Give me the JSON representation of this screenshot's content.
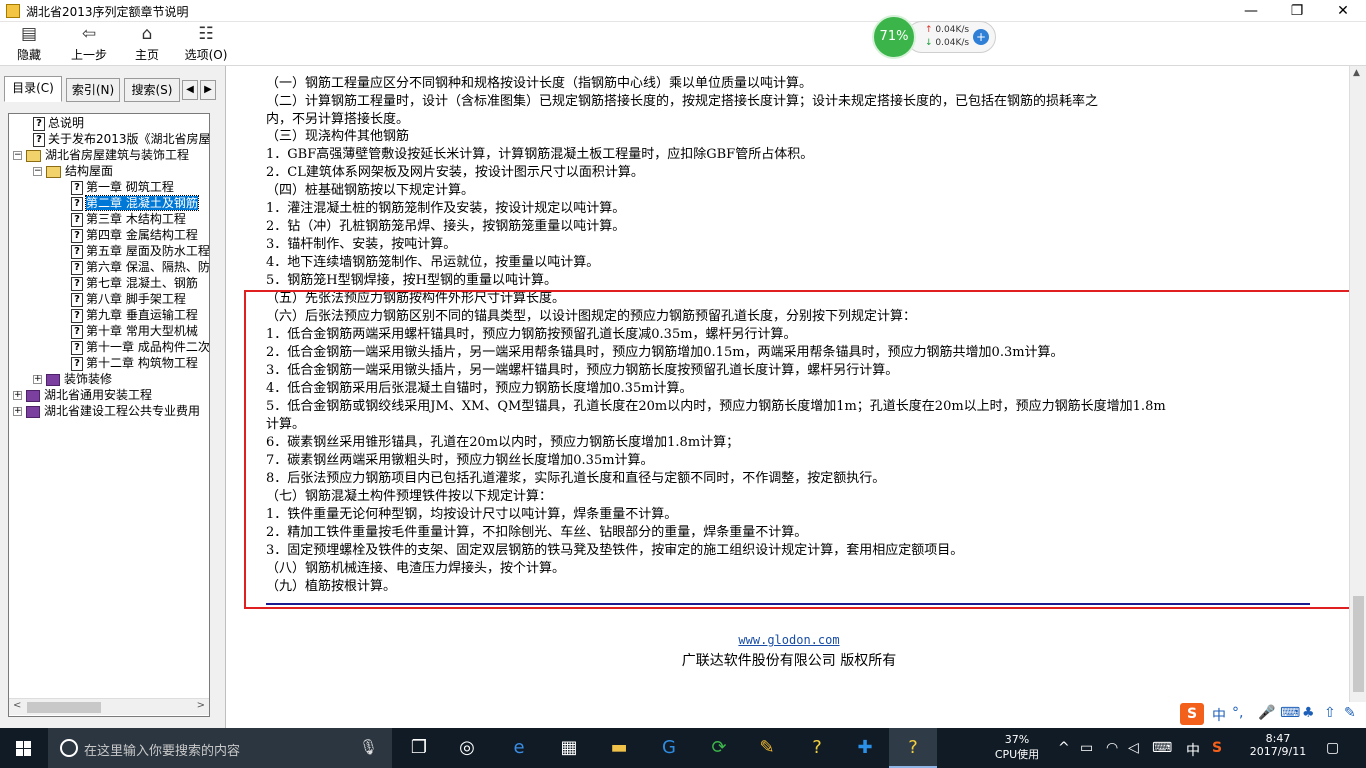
{
  "window": {
    "title": "湖北省2013序列定额章节说明",
    "controls": {
      "minimize": "—",
      "maximize": "❐",
      "close": "✕"
    }
  },
  "toolbar": {
    "hide": "隐藏",
    "back": "上一步",
    "home": "主页",
    "options": "选项(O)"
  },
  "monitor": {
    "percent": "71%",
    "upload": "0.04K/s",
    "download": "0.04K/s"
  },
  "sidebar": {
    "tabs": [
      "目录(C)",
      "索引(N)",
      "搜索(S)"
    ],
    "tree": [
      "总说明",
      "关于发布2013版《湖北省房屋",
      "湖北省房屋建筑与装饰工程",
      "结构屋面",
      "第一章 砌筑工程",
      "第二章 混凝土及钢筋",
      "第三章 木结构工程",
      "第四章 金属结构工程",
      "第五章 屋面及防水工程",
      "第六章 保温、隔热、防",
      "第七章 混凝土、钢筋",
      "第八章 脚手架工程",
      "第九章 垂直运输工程",
      "第十章 常用大型机械",
      "第十一章 成品构件二次",
      "第十二章 构筑物工程",
      "装饰装修",
      "湖北省通用安装工程",
      "湖北省建设工程公共专业费用"
    ]
  },
  "content": {
    "lines": [
      "（一）钢筋工程量应区分不同钢种和规格按设计长度（指钢筋中心线）乘以单位质量以吨计算。",
      "（二）计算钢筋工程量时，设计（含标准图集）已规定钢筋搭接长度的，按规定搭接长度计算；设计未规定搭接长度的，已包括在钢筋的损耗率之",
      "内，不另计算搭接长度。",
      "（三）现浇构件其他钢筋",
      "1．GBF高强薄壁管敷设按延长米计算，计算钢筋混凝土板工程量时，应扣除GBF管所占体积。",
      "2．CL建筑体系网架板及网片安装，按设计图示尺寸以面积计算。",
      "（四）桩基础钢筋按以下规定计算。",
      "1．灌注混凝土桩的钢筋笼制作及安装，按设计规定以吨计算。",
      "2．钻（冲）孔桩钢筋笼吊焊、接头，按钢筋笼重量以吨计算。",
      "3．锚杆制作、安装，按吨计算。",
      "4．地下连续墙钢筋笼制作、吊运就位，按重量以吨计算。",
      "5．钢筋笼H型钢焊接，按H型钢的重量以吨计算。",
      "（五）先张法预应力钢筋按构件外形尺寸计算长度。",
      "（六）后张法预应力钢筋区别不同的锚具类型，以设计图规定的预应力钢筋预留孔道长度，分别按下列规定计算：",
      "1．低合金钢筋两端采用螺杆锚具时，预应力钢筋按预留孔道长度减0.35m，螺杆另行计算。",
      "2．低合金钢筋一端采用镦头插片，另一端采用帮条锚具时，预应力钢筋增加0.15m，两端采用帮条锚具时，预应力钢筋共增加0.3m计算。",
      "3．低合金钢筋一端采用镦头插片，另一端螺杆锚具时，预应力钢筋长度按预留孔道长度计算，螺杆另行计算。",
      "4．低合金钢筋采用后张混凝土自锚时，预应力钢筋长度增加0.35m计算。",
      "5．低合金钢筋或钢绞线采用JM、XM、QM型锚具，孔道长度在20m以内时，预应力钢筋长度增加1m；孔道长度在20m以上时，预应力钢筋长度增加1.8m",
      "计算。",
      "6．碳素钢丝采用锥形锚具，孔道在20m以内时，预应力钢筋长度增加1.8m计算；",
      "7．碳素钢丝两端采用镦粗头时，预应力钢丝长度增加0.35m计算。",
      "8．后张法预应力钢筋项目内已包括孔道灌浆，实际孔道长度和直径与定额不同时，不作调整，按定额执行。",
      "（七）钢筋混凝土构件预埋铁件按以下规定计算：",
      "1．铁件重量无论何种型钢，均按设计尺寸以吨计算，焊条重量不计算。",
      "2．精加工铁件重量按毛件重量计算，不扣除刨光、车丝、钻眼部分的重量，焊条重量不计算。",
      "3．固定预埋螺栓及铁件的支架、固定双层钢筋的铁马凳及垫铁件，按审定的施工组织设计规定计算，套用相应定额项目。",
      "（八）钢筋机械连接、电渣压力焊接头，按个计算。",
      "（九）植筋按根计算。"
    ],
    "footer_link": "www.glodon.com",
    "footer_copy": "广联达软件股份有限公司 版权所有"
  },
  "ime": {
    "logo": "S",
    "lang": "中",
    "punct": "°,"
  },
  "taskbar": {
    "search_placeholder": "在这里输入你要搜索的内容",
    "cpu_percent": "37%",
    "cpu_label": "CPU使用",
    "lang": "中",
    "time": "8:47",
    "date": "2017/9/11"
  },
  "colors": {
    "highlight": "#e02020",
    "accent": "#0078d7",
    "taskbar": "#101b25"
  }
}
